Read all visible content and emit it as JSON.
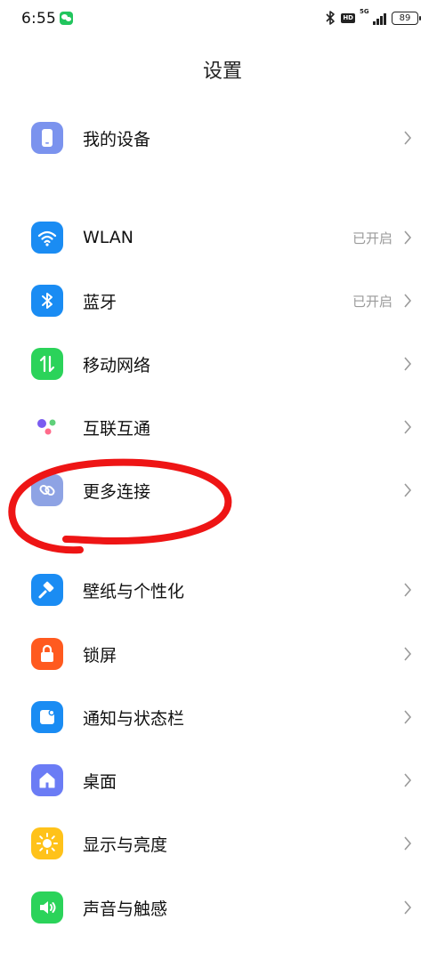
{
  "status_bar": {
    "time": "6:55",
    "hd": "HD",
    "network": "5G",
    "battery": "89",
    "icons": [
      "wechat-icon",
      "bluetooth-icon",
      "hd-icon",
      "signal-icon",
      "battery-icon"
    ]
  },
  "header": {
    "title": "设置"
  },
  "settings": {
    "my_device": {
      "label": "我的设备",
      "icon": "phone-icon",
      "color": "#7b93ee"
    },
    "wlan": {
      "label": "WLAN",
      "value": "已开启",
      "icon": "wifi-icon",
      "color": "#1a8cf3"
    },
    "bluetooth": {
      "label": "蓝牙",
      "value": "已开启",
      "icon": "bluetooth-icon",
      "color": "#1a8cf3"
    },
    "mobile_network": {
      "label": "移动网络",
      "icon": "mobile-data-icon",
      "color": "#2bd35a"
    },
    "interconnect": {
      "label": "互联互通",
      "icon": "dots-icon"
    },
    "more_connections": {
      "label": "更多连接",
      "icon": "link-icon",
      "color": "#8ea3e4"
    },
    "wallpaper": {
      "label": "壁纸与个性化",
      "icon": "paint-brush-icon",
      "color": "#1a8cf3"
    },
    "lock_screen": {
      "label": "锁屏",
      "icon": "lock-icon",
      "color": "#ff5a1f"
    },
    "notifications": {
      "label": "通知与状态栏",
      "icon": "notification-icon",
      "color": "#1a8cf3"
    },
    "desktop": {
      "label": "桌面",
      "icon": "home-icon",
      "color": "#6b7cf5"
    },
    "display": {
      "label": "显示与亮度",
      "icon": "sun-icon",
      "color": "#ffc21a"
    },
    "sound": {
      "label": "声音与触感",
      "icon": "speaker-icon",
      "color": "#2bd35a"
    }
  },
  "annotation": {
    "color": "#ee1515",
    "type": "hand-drawn-circle"
  }
}
